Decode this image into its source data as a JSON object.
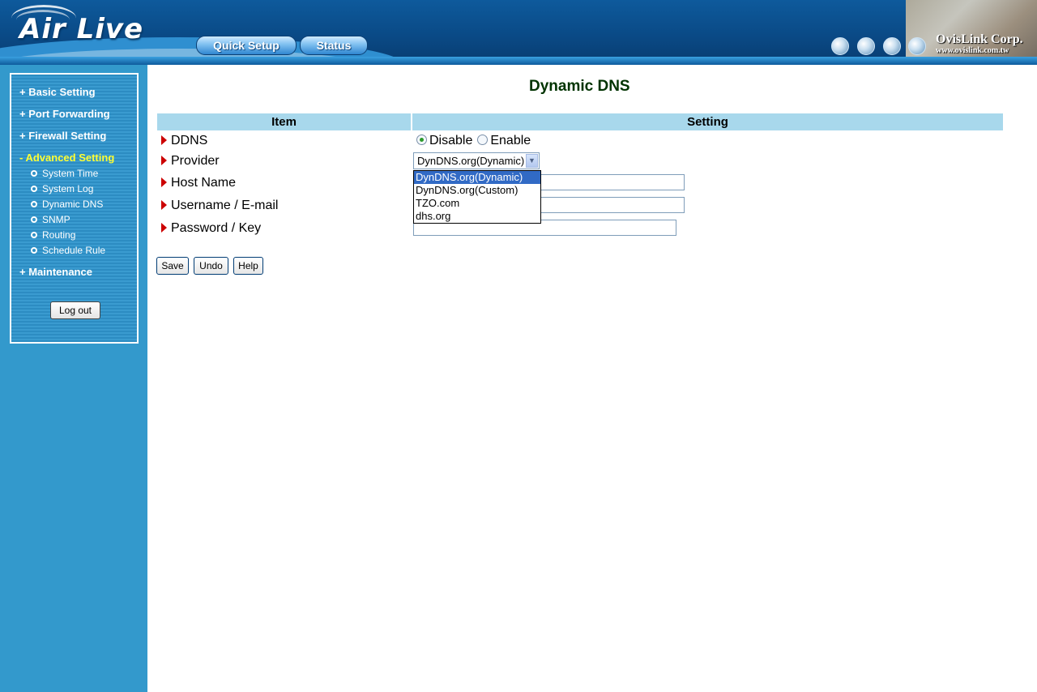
{
  "header": {
    "logo_text": "Air Live",
    "nav": [
      {
        "label": "Quick Setup"
      },
      {
        "label": "Status"
      }
    ],
    "corp_name": "OvisLink Corp.",
    "corp_url": "www.ovislink.com.tw"
  },
  "sidebar": {
    "menu": [
      {
        "label": "+ Basic Setting"
      },
      {
        "label": "+ Port Forwarding"
      },
      {
        "label": "+ Firewall Setting"
      },
      {
        "label": "- Advanced Setting"
      },
      {
        "label": "+ Maintenance"
      }
    ],
    "submenu": [
      {
        "label": "System Time"
      },
      {
        "label": "System Log"
      },
      {
        "label": "Dynamic DNS"
      },
      {
        "label": "SNMP"
      },
      {
        "label": "Routing"
      },
      {
        "label": "Schedule Rule"
      }
    ],
    "logout_label": "Log out"
  },
  "main": {
    "title": "Dynamic DNS",
    "col_item": "Item",
    "col_setting": "Setting",
    "rows": {
      "ddns": "DDNS",
      "provider": "Provider",
      "host": "Host Name",
      "username": "Username / E-mail",
      "password": "Password / Key"
    },
    "ddns_options": {
      "disable": "Disable",
      "enable": "Enable",
      "selected": "Disable"
    },
    "provider_selected": "DynDNS.org(Dynamic)",
    "provider_options": [
      "DynDNS.org(Dynamic)",
      "DynDNS.org(Custom)",
      "TZO.com",
      "dhs.org"
    ],
    "host_value": "",
    "username_value": "",
    "password_value": "",
    "buttons": {
      "save": "Save",
      "undo": "Undo",
      "help": "Help"
    }
  },
  "colors": {
    "header_blue": "#0a4a86",
    "sidebar_blue": "#3399cc",
    "active_menu": "#ffff33",
    "table_header": "#a8d8ec",
    "title_green": "#003300",
    "arrow_red": "#cc0000",
    "option_highlight": "#316ac5"
  }
}
